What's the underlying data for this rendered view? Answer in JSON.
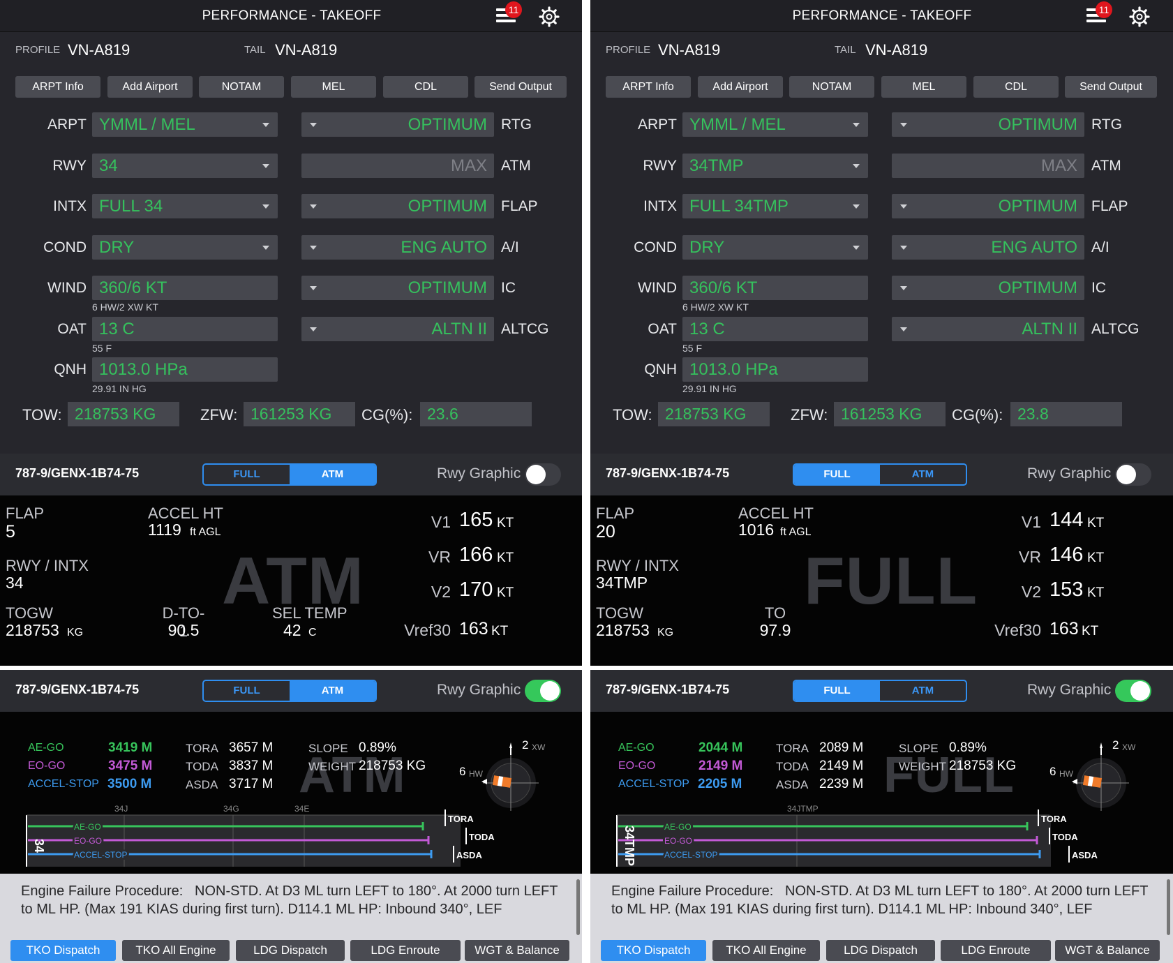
{
  "header": {
    "title": "PERFORMANCE - TAKEOFF",
    "badge_count": "11"
  },
  "profile": {
    "profile_label": "PROFILE",
    "profile_value": "VN-A819",
    "tail_label": "TAIL",
    "tail_value": "VN-A819"
  },
  "toolbar": [
    "ARPT Info",
    "Add Airport",
    "NOTAM",
    "MEL",
    "CDL",
    "Send Output"
  ],
  "labels": {
    "left": [
      "ARPT",
      "RWY",
      "INTX",
      "COND",
      "WIND",
      "OAT",
      "QNH"
    ],
    "right": [
      "RTG",
      "ATM",
      "FLAP",
      "A/I",
      "IC",
      "ALTCG"
    ],
    "tow": "TOW:",
    "zfw": "ZFW:",
    "cg": "CG(%):",
    "rwy_graphic": "Rwy Graphic",
    "full": "FULL",
    "atm": "ATM",
    "flap": "FLAP",
    "accel_ht": "ACCEL HT",
    "rwy_intx": "RWY / INTX",
    "togw": "TOGW",
    "dto1": "D-TO-1",
    "seltemp": "SEL TEMP",
    "to": "TO",
    "v1": "V1",
    "vr": "VR",
    "v2": "V2",
    "vref": "Vref30",
    "kt": "KT",
    "kg": "KG",
    "ftagl": "ft AGL",
    "c": "C",
    "ae_go": "AE-GO",
    "eo_go": "EO-GO",
    "accel_stop": "ACCEL-STOP",
    "tora": "TORA",
    "toda": "TODA",
    "asda": "ASDA",
    "slope": "SLOPE",
    "weight": "WEIGHT",
    "hw": "HW",
    "xw": "XW",
    "efp_label": "Engine Failure Procedure:"
  },
  "screens": [
    {
      "inputs": {
        "arpt": "YMML / MEL",
        "rwy": "34",
        "intx": "FULL 34",
        "cond": "DRY",
        "wind": "360/6 KT",
        "wind_sub": "6 HW/2 XW KT",
        "oat": "13 C",
        "oat_sub": "55 F",
        "qnh": "1013.0 HPa",
        "qnh_sub": "29.91 IN HG",
        "rtg": "OPTIMUM",
        "atm": "MAX",
        "flap": "OPTIMUM",
        "ai": "ENG AUTO",
        "ic": "OPTIMUM",
        "altcg": "ALTN II",
        "tow": "218753 KG",
        "zfw": "161253 KG",
        "cg": "23.6"
      },
      "aircraft": "787-9/GENX-1B74-75",
      "mode": "ATM",
      "rwy_graphic_on": false,
      "result": {
        "flap": "5",
        "accel_ht": "1119",
        "rwy_intx": "34",
        "togw": "218753",
        "d_label": "D-TO-1",
        "d_value": "90.5",
        "sel_temp": "42",
        "v1": "165",
        "vr": "166",
        "v2": "170",
        "vref30": "163"
      }
    },
    {
      "inputs": {
        "arpt": "YMML / MEL",
        "rwy": "34TMP",
        "intx": "FULL 34TMP",
        "cond": "DRY",
        "wind": "360/6 KT",
        "wind_sub": "6 HW/2 XW KT",
        "oat": "13 C",
        "oat_sub": "55 F",
        "qnh": "1013.0 HPa",
        "qnh_sub": "29.91 IN HG",
        "rtg": "OPTIMUM",
        "atm": "MAX",
        "flap": "OPTIMUM",
        "ai": "ENG AUTO",
        "ic": "OPTIMUM",
        "altcg": "ALTN II",
        "tow": "218753 KG",
        "zfw": "161253 KG",
        "cg": "23.8"
      },
      "aircraft": "787-9/GENX-1B74-75",
      "mode": "FULL",
      "rwy_graphic_on": false,
      "result": {
        "flap": "20",
        "accel_ht": "1016",
        "rwy_intx": "34TMP",
        "togw": "218753",
        "d_label": "TO",
        "d_value": "97.9",
        "v1": "144",
        "vr": "146",
        "v2": "153",
        "vref30": "163"
      }
    },
    {
      "aircraft": "787-9/GENX-1B74-75",
      "mode": "ATM",
      "rwy_graphic_on": true,
      "dist": {
        "ae_go": "3419 M",
        "eo_go": "3475 M",
        "accel_stop": "3500 M",
        "tora": "3657 M",
        "toda": "3837 M",
        "asda": "3717 M",
        "slope": "0.89%",
        "weight": "218753 KG",
        "wind_xw": "2",
        "wind_hw": "6",
        "rwy": "34",
        "intx_marks": [
          "34J",
          "34G",
          "34E"
        ]
      },
      "efp": "NON-STD. At D3 ML turn LEFT to 180°. At 2000 turn LEFT to ML HP. (Max 191 KIAS during first turn). D114.1 ML HP: Inbound 340°, LEF"
    },
    {
      "aircraft": "787-9/GENX-1B74-75",
      "mode": "FULL",
      "rwy_graphic_on": true,
      "dist": {
        "ae_go": "2044 M",
        "eo_go": "2149 M",
        "accel_stop": "2205 M",
        "tora": "2089 M",
        "toda": "2149 M",
        "asda": "2239 M",
        "slope": "0.89%",
        "weight": "218753 KG",
        "wind_xw": "2",
        "wind_hw": "6",
        "rwy": "34TMP",
        "intx_marks": [
          "34JTMP"
        ]
      },
      "efp": "NON-STD. At D3 ML turn LEFT to 180°. At 2000 turn LEFT to ML HP. (Max 191 KIAS during first turn). D114.1 ML HP: Inbound 340°, LEF"
    }
  ],
  "bottom_tabs": [
    "TKO Dispatch",
    "TKO All Engine",
    "LDG Dispatch",
    "LDG Enroute",
    "WGT & Balance"
  ],
  "colors": {
    "accent_blue": "#2f8ef0",
    "value_green": "#35c15d",
    "toggle_green": "#35c85b",
    "ae_go": "#37c45b",
    "eo_go": "#c35ad6",
    "accel_stop": "#3d9bf0",
    "badge_red": "#e0161d"
  }
}
